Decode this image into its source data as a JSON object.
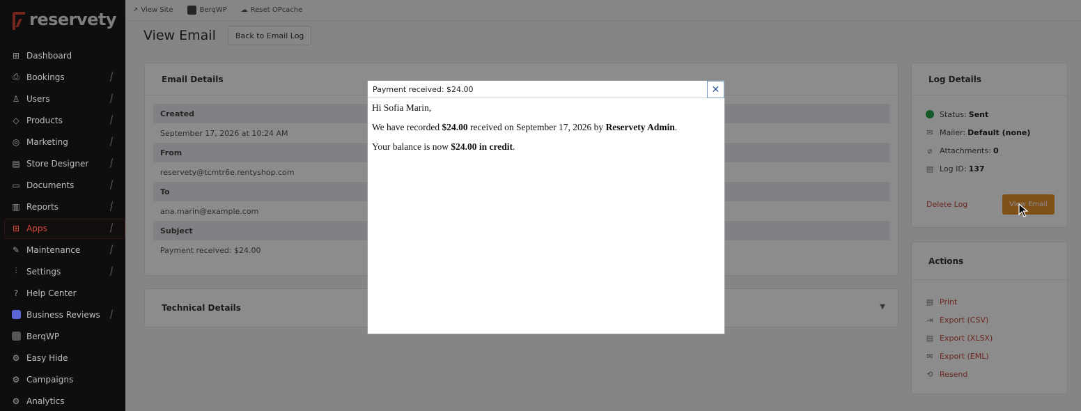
{
  "brand": {
    "name": "reservety",
    "accent": "#d6483a"
  },
  "sidebar": {
    "items": [
      {
        "label": "Dashboard",
        "icon": "dashboard-icon",
        "chevron": false
      },
      {
        "label": "Bookings",
        "icon": "bookings-icon",
        "chevron": true
      },
      {
        "label": "Users",
        "icon": "user-icon",
        "chevron": true
      },
      {
        "label": "Products",
        "icon": "tag-icon",
        "chevron": true
      },
      {
        "label": "Marketing",
        "icon": "marketing-icon",
        "chevron": true
      },
      {
        "label": "Store Designer",
        "icon": "store-icon",
        "chevron": true
      },
      {
        "label": "Documents",
        "icon": "documents-icon",
        "chevron": true
      },
      {
        "label": "Reports",
        "icon": "reports-icon",
        "chevron": true
      },
      {
        "label": "Apps",
        "icon": "apps-icon",
        "chevron": true,
        "active": true
      },
      {
        "label": "Maintenance",
        "icon": "wrench-icon",
        "chevron": true
      },
      {
        "label": "Settings",
        "icon": "settings-sliders-icon",
        "chevron": true
      },
      {
        "label": "Help Center",
        "icon": "help-icon",
        "chevron": false
      },
      {
        "label": "Business Reviews",
        "icon": "reviews-icon",
        "chevron": true
      },
      {
        "label": "BerqWP",
        "icon": "berqwp-icon",
        "chevron": false
      },
      {
        "label": "Easy Hide",
        "icon": "gear-icon",
        "chevron": false
      },
      {
        "label": "Campaigns",
        "icon": "gear-icon",
        "chevron": false
      },
      {
        "label": "Analytics",
        "icon": "gear-icon",
        "chevron": false
      }
    ]
  },
  "topbar": {
    "view_site": "View Site",
    "berqwp": "BerqWP",
    "reset_opcache": "Reset OPcache"
  },
  "page": {
    "title": "View Email",
    "back_button": "Back to Email Log"
  },
  "email_details": {
    "header": "Email Details",
    "rows": [
      {
        "label": "Created",
        "value": "September 17, 2026 at 10:24 AM"
      },
      {
        "label": "From",
        "value": "reservety@tcmtr6e.rentyshop.com"
      },
      {
        "label": "To",
        "value": "ana.marin@example.com"
      },
      {
        "label": "Subject",
        "value": "Payment received: $24.00"
      }
    ]
  },
  "technical_details": {
    "header": "Technical Details"
  },
  "log_details": {
    "header": "Log Details",
    "status_label": "Status:",
    "status_value": "Sent",
    "mailer_label": "Mailer:",
    "mailer_value": "Default (none)",
    "attachments_label": "Attachments:",
    "attachments_value": "0",
    "log_id_label": "Log ID:",
    "log_id_value": "137",
    "delete_label": "Delete Log",
    "view_label": "View Email"
  },
  "actions": {
    "header": "Actions",
    "items": [
      {
        "label": "Print",
        "icon": "document-icon"
      },
      {
        "label": "Export (CSV)",
        "icon": "export-icon"
      },
      {
        "label": "Export (XLSX)",
        "icon": "document-icon"
      },
      {
        "label": "Export (EML)",
        "icon": "envelope-icon"
      },
      {
        "label": "Resend",
        "icon": "resend-icon"
      }
    ]
  },
  "modal": {
    "title": "Payment received: $24.00",
    "greeting": "Hi Sofia Marin,",
    "line1_pre": "We have recorded ",
    "line1_amount": "$24.00",
    "line1_mid": " received on September 17, 2026 by ",
    "line1_by": "Reservety Admin",
    "line1_end": ".",
    "line2_pre": "Your balance is now ",
    "line2_bold": "$24.00 in credit",
    "line2_end": "."
  }
}
